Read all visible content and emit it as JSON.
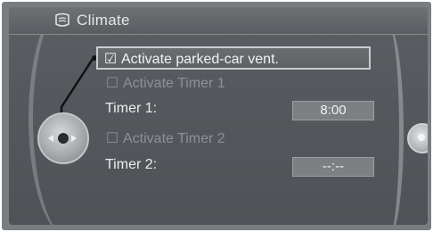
{
  "header": {
    "title": "Climate"
  },
  "menu": {
    "activate_parked_car_vent": {
      "label": "Activate parked-car vent.",
      "checked": true
    },
    "activate_timer_1": {
      "label": "Activate Timer 1",
      "checked": false
    },
    "timer_1": {
      "label": "Timer 1:",
      "value": "8:00"
    },
    "activate_timer_2": {
      "label": "Activate Timer 2",
      "checked": false
    },
    "timer_2": {
      "label": "Timer 2:",
      "value": "--:--"
    }
  },
  "glyphs": {
    "checked": "☑",
    "unchecked": "☐"
  },
  "colors": {
    "screen_bg": "#55585c",
    "highlight_border": "#c9cbcd",
    "dim_text": "#8d9094"
  }
}
